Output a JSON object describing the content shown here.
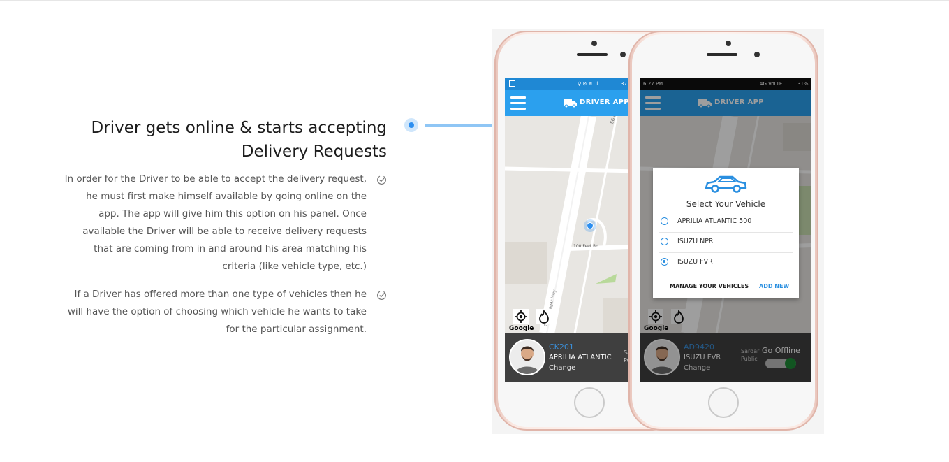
{
  "feature": {
    "title_line1": "Driver gets online & starts accepting",
    "title_line2": "Delivery Requests",
    "paragraph1": "In order for the Driver to be able to accept the delivery request, he must first make himself available by going online on the app. The app will give him this option on his panel. Once available the Driver will be able to receive delivery requests that are coming from in and around his area matching his criteria (like vehicle type, etc.)",
    "paragraph2": "If a Driver has offered more than one type of vehicles then he will have the option of choosing which vehicle he wants to take for the particular assignment."
  },
  "phone_left": {
    "status_battery": "37",
    "app_title": "DRIVER APP",
    "map_labels": [
      "SG Hwy Service Rd",
      "100 Feet Rd",
      "Gandhinagar Hwy"
    ],
    "vehicle_code": "CK201",
    "vehicle_name": "APRILIA ATLANTIC",
    "change_label": "Change",
    "google_label": "Google",
    "side_text": "Sardar P",
    "side_text2": "Public A"
  },
  "phone_right": {
    "status_time": "6:27 PM",
    "status_right": "4G VoLTE",
    "status_battery": "31%",
    "app_title": "DRIVER APP",
    "dialog_title": "Select Your Vehicle",
    "options": [
      {
        "label": "APRILIA ATLANTIC 500",
        "selected": false
      },
      {
        "label": "ISUZU NPR",
        "selected": false
      },
      {
        "label": "ISUZU FVR",
        "selected": true
      }
    ],
    "manage_label": "MANAGE YOUR VEHICLES",
    "add_new_label": "ADD NEW",
    "vehicle_code": "AD9420",
    "vehicle_name": "ISUZU FVR",
    "change_label": "Change",
    "go_offline_label": "Go Offline",
    "google_label": "Google",
    "side_text": "Sardar",
    "side_text2": "Public"
  },
  "colors": {
    "accent": "#2d8ff0",
    "appbar": "#2ba0ee",
    "appbar_dim": "#1a5a87",
    "toggle_on": "#1e8a36"
  }
}
